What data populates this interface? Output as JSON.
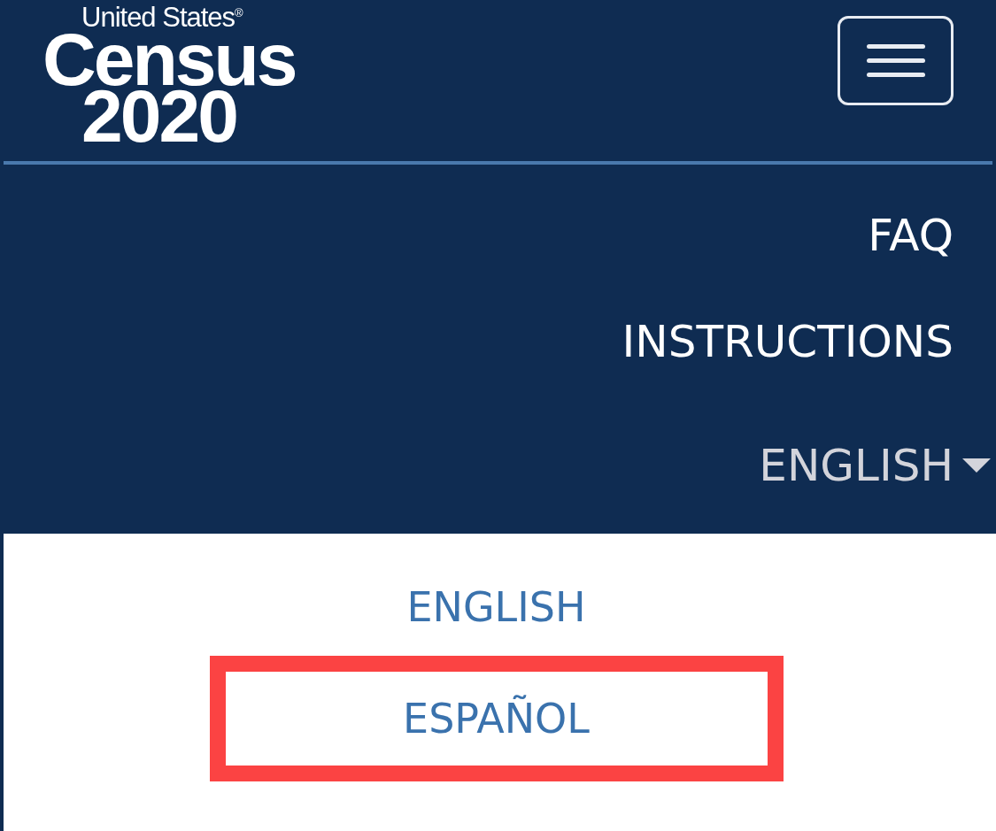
{
  "logo": {
    "line_1": "United States",
    "registered": "®",
    "line_2": "Census",
    "line_3": "2020"
  },
  "nav": {
    "links": [
      {
        "label": "FAQ"
      },
      {
        "label": "INSTRUCTIONS"
      }
    ],
    "language_toggle": {
      "label": "ENGLISH",
      "expanded": true
    }
  },
  "language_menu": {
    "options": [
      {
        "label": "ENGLISH",
        "highlighted": false
      },
      {
        "label": "ESPAÑOL",
        "highlighted": true
      }
    ]
  }
}
